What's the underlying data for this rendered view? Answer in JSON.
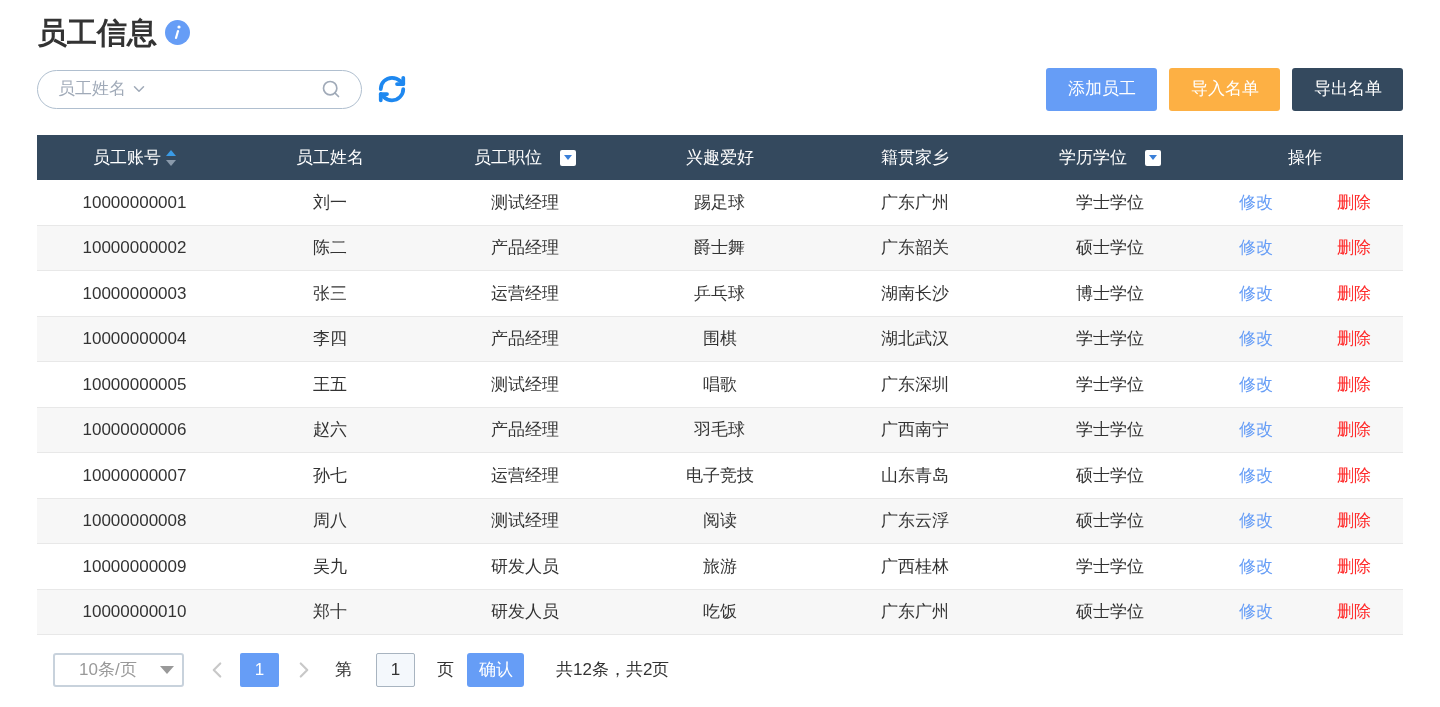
{
  "title": "员工信息",
  "search": {
    "field_label": "员工姓名"
  },
  "buttons": [
    {
      "label": "添加员工",
      "kind": "primary"
    },
    {
      "label": "导入名单",
      "kind": "warning"
    },
    {
      "label": "导出名单",
      "kind": "dark"
    }
  ],
  "table": {
    "columns": [
      {
        "label": "员工账号",
        "kind": "sort",
        "sorted_ascending": true
      },
      {
        "label": "员工姓名",
        "kind": "plain"
      },
      {
        "label": "员工职位",
        "kind": "filter"
      },
      {
        "label": "兴趣爱好",
        "kind": "plain"
      },
      {
        "label": "籍贯家乡",
        "kind": "plain"
      },
      {
        "label": "学历学位",
        "kind": "filter"
      },
      {
        "label": "操作",
        "kind": "actions"
      }
    ],
    "rows": [
      {
        "cells": [
          "10000000001",
          "刘一",
          "测试经理",
          "踢足球",
          "广东广州",
          "学士学位"
        ],
        "actions": [
          {
            "label": "修改",
            "kind": "edit"
          },
          {
            "label": "删除",
            "kind": "delete"
          }
        ]
      },
      {
        "cells": [
          "10000000002",
          "陈二",
          "产品经理",
          "爵士舞",
          "广东韶关",
          "硕士学位"
        ],
        "actions": [
          {
            "label": "修改",
            "kind": "edit"
          },
          {
            "label": "删除",
            "kind": "delete"
          }
        ]
      },
      {
        "cells": [
          "10000000003",
          "张三",
          "运营经理",
          "乒乓球",
          "湖南长沙",
          "博士学位"
        ],
        "actions": [
          {
            "label": "修改",
            "kind": "edit"
          },
          {
            "label": "删除",
            "kind": "delete"
          }
        ]
      },
      {
        "cells": [
          "10000000004",
          "李四",
          "产品经理",
          "围棋",
          "湖北武汉",
          "学士学位"
        ],
        "actions": [
          {
            "label": "修改",
            "kind": "edit"
          },
          {
            "label": "删除",
            "kind": "delete"
          }
        ]
      },
      {
        "cells": [
          "10000000005",
          "王五",
          "测试经理",
          "唱歌",
          "广东深圳",
          "学士学位"
        ],
        "actions": [
          {
            "label": "修改",
            "kind": "edit"
          },
          {
            "label": "删除",
            "kind": "delete"
          }
        ]
      },
      {
        "cells": [
          "10000000006",
          "赵六",
          "产品经理",
          "羽毛球",
          "广西南宁",
          "学士学位"
        ],
        "actions": [
          {
            "label": "修改",
            "kind": "edit"
          },
          {
            "label": "删除",
            "kind": "delete"
          }
        ]
      },
      {
        "cells": [
          "10000000007",
          "孙七",
          "运营经理",
          "电子竞技",
          "山东青岛",
          "硕士学位"
        ],
        "actions": [
          {
            "label": "修改",
            "kind": "edit"
          },
          {
            "label": "删除",
            "kind": "delete"
          }
        ]
      },
      {
        "cells": [
          "10000000008",
          "周八",
          "测试经理",
          "阅读",
          "广东云浮",
          "硕士学位"
        ],
        "actions": [
          {
            "label": "修改",
            "kind": "edit"
          },
          {
            "label": "删除",
            "kind": "delete"
          }
        ]
      },
      {
        "cells": [
          "10000000009",
          "吴九",
          "研发人员",
          "旅游",
          "广西桂林",
          "学士学位"
        ],
        "actions": [
          {
            "label": "修改",
            "kind": "edit"
          },
          {
            "label": "删除",
            "kind": "delete"
          }
        ]
      },
      {
        "cells": [
          "10000000010",
          "郑十",
          "研发人员",
          "吃饭",
          "广东广州",
          "硕士学位"
        ],
        "actions": [
          {
            "label": "修改",
            "kind": "edit"
          },
          {
            "label": "删除",
            "kind": "delete"
          }
        ]
      }
    ]
  },
  "pagination": {
    "page_size": "10条/页",
    "pages": [
      {
        "label": "1",
        "selected": true
      }
    ],
    "goto_prefix": "第",
    "goto_value": "1",
    "goto_suffix": "页",
    "confirm": "确认",
    "summary": "共12条，共2页"
  }
}
